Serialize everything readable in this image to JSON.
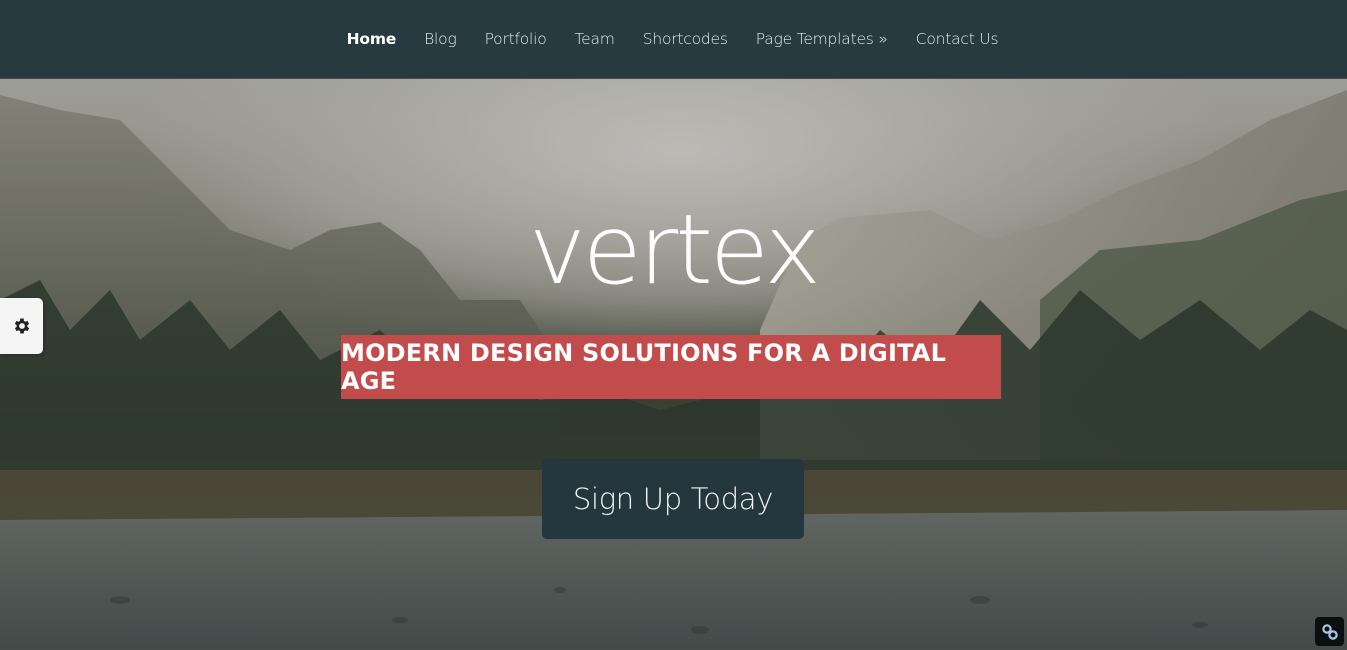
{
  "nav": {
    "items": [
      {
        "label": "Home",
        "active": true
      },
      {
        "label": "Blog",
        "active": false
      },
      {
        "label": "Portfolio",
        "active": false
      },
      {
        "label": "Team",
        "active": false
      },
      {
        "label": "Shortcodes",
        "active": false
      },
      {
        "label": "Page Templates »",
        "active": false
      },
      {
        "label": "Contact Us",
        "active": false
      }
    ]
  },
  "hero": {
    "logo_text": "vertex",
    "tagline": "MODERN DESIGN SOLUTIONS FOR A DIGITAL AGE",
    "cta_label": "Sign Up Today",
    "background": "mountain-valley-river-photo"
  },
  "widgets": {
    "settings_icon": "gear-icon",
    "corner_icon": "link-icon"
  },
  "colors": {
    "navbar": "#263a40",
    "tagline_bg": "#c24b4b",
    "cta_bg": "#25373e"
  }
}
